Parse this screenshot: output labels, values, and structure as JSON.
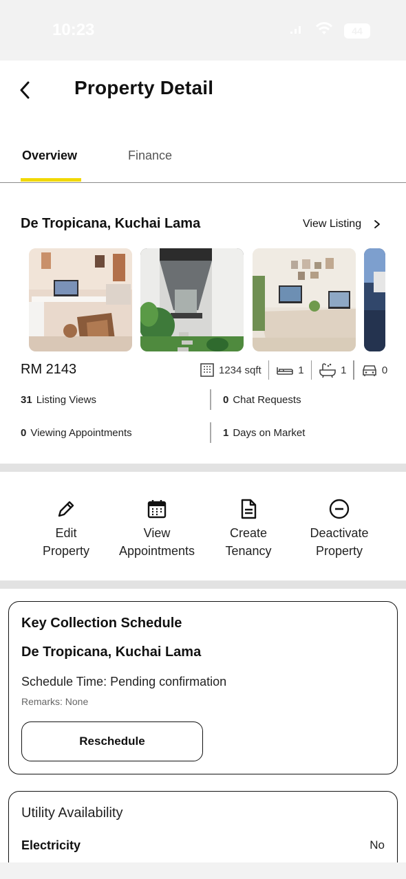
{
  "status": {
    "time": "10:23",
    "battery": "44"
  },
  "header": {
    "title": "Property Detail"
  },
  "tabs": [
    {
      "label": "Overview"
    },
    {
      "label": "Finance"
    }
  ],
  "property": {
    "name": "De Tropicana, Kuchai Lama",
    "view_listing": "View Listing",
    "price": "RM 2143",
    "sqft": "1234 sqft",
    "beds": "1",
    "baths": "1",
    "parking": "0"
  },
  "stats": [
    {
      "value": "31",
      "label": "Listing Views"
    },
    {
      "value": "0",
      "label": "Chat Requests"
    },
    {
      "value": "0",
      "label": "Viewing Appointments"
    },
    {
      "value": "1",
      "label": "Days on Market"
    }
  ],
  "actions": [
    {
      "line1": "Edit",
      "line2": "Property",
      "icon": "pencil-icon"
    },
    {
      "line1": "View",
      "line2": "Appointments",
      "icon": "calendar-icon"
    },
    {
      "line1": "Create",
      "line2": "Tenancy",
      "icon": "document-icon"
    },
    {
      "line1": "Deactivate",
      "line2": "Property",
      "icon": "minus-circle-icon"
    }
  ],
  "key_collection": {
    "title": "Key Collection Schedule",
    "property": "De Tropicana, Kuchai Lama",
    "schedule": "Schedule Time: Pending confirmation",
    "remarks": "Remarks: None",
    "button": "Reschedule"
  },
  "utility": {
    "title": "Utility Availability",
    "items": [
      {
        "label": "Electricity",
        "value": "No"
      }
    ]
  },
  "colors": {
    "accent": "#f1d800",
    "divider": "#e2e2e2"
  }
}
